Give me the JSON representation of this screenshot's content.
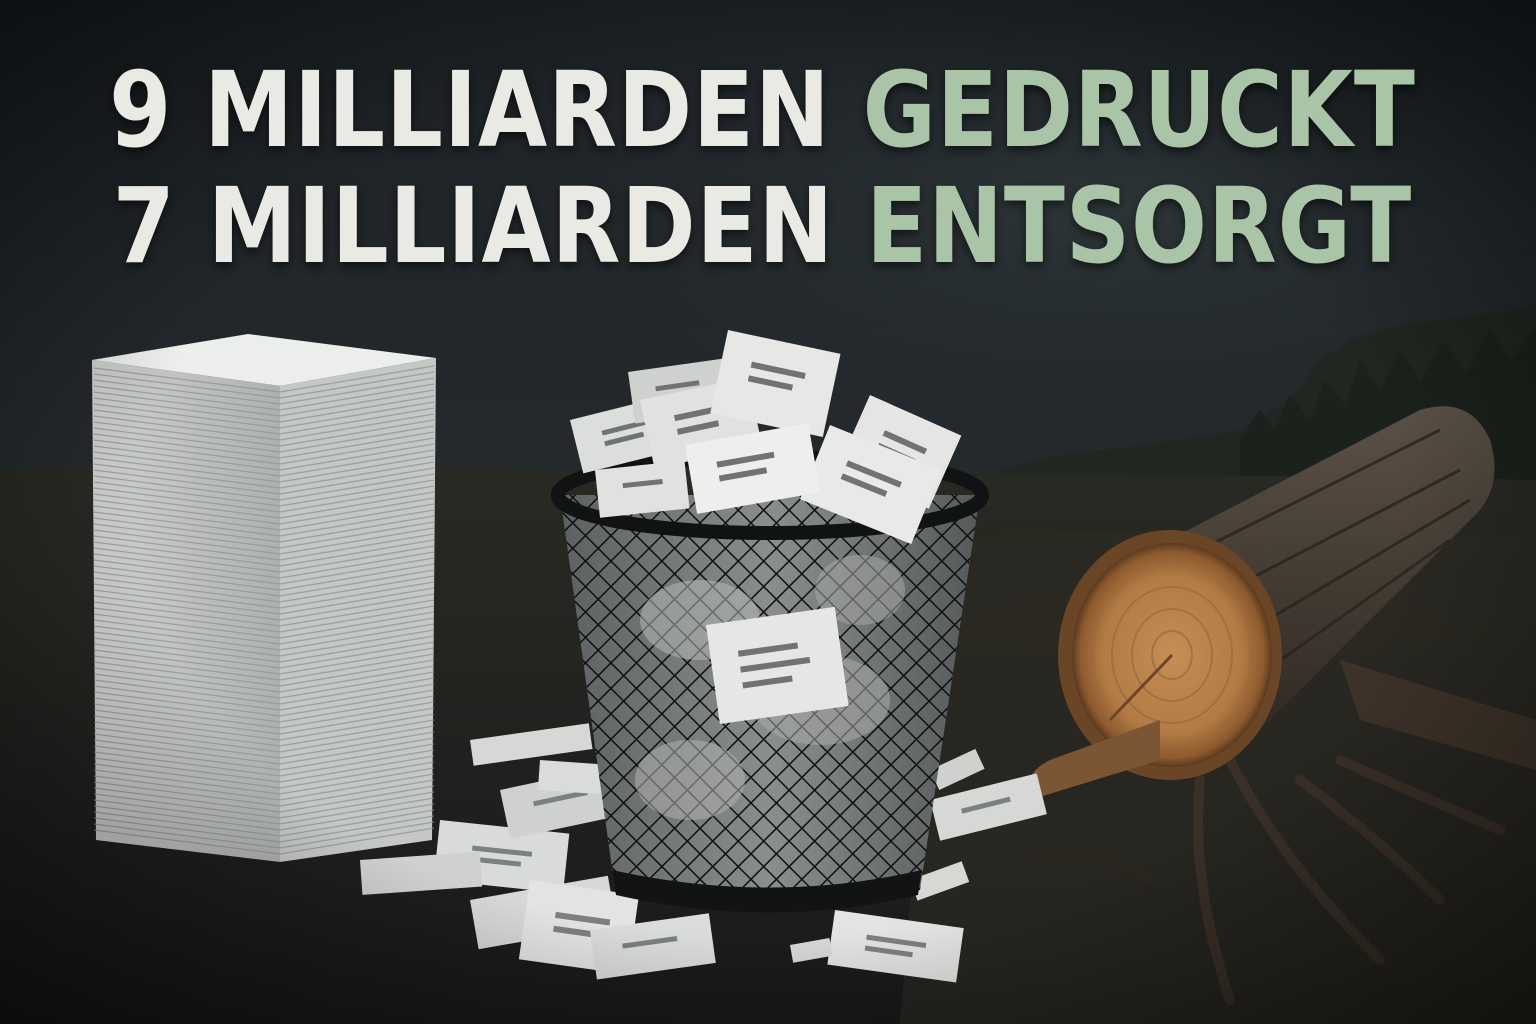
{
  "headline": {
    "line1_number": "9 MILLIARDEN",
    "line1_word": "GEDRUCKT",
    "line2_number": "7 MILLIARDEN",
    "line2_word": "ENTSORGT"
  },
  "colors": {
    "background": "#1a1c1d",
    "text_primary": "#e9eae4",
    "text_accent": "#a9c4a6",
    "paper": "#dfe0dc",
    "basket": "#141617",
    "wood": "#b07a45",
    "bark": "#4a4036"
  },
  "scene": {
    "elements": [
      "paper-stack",
      "waste-basket",
      "scattered-papers",
      "felled-tree-log"
    ]
  }
}
